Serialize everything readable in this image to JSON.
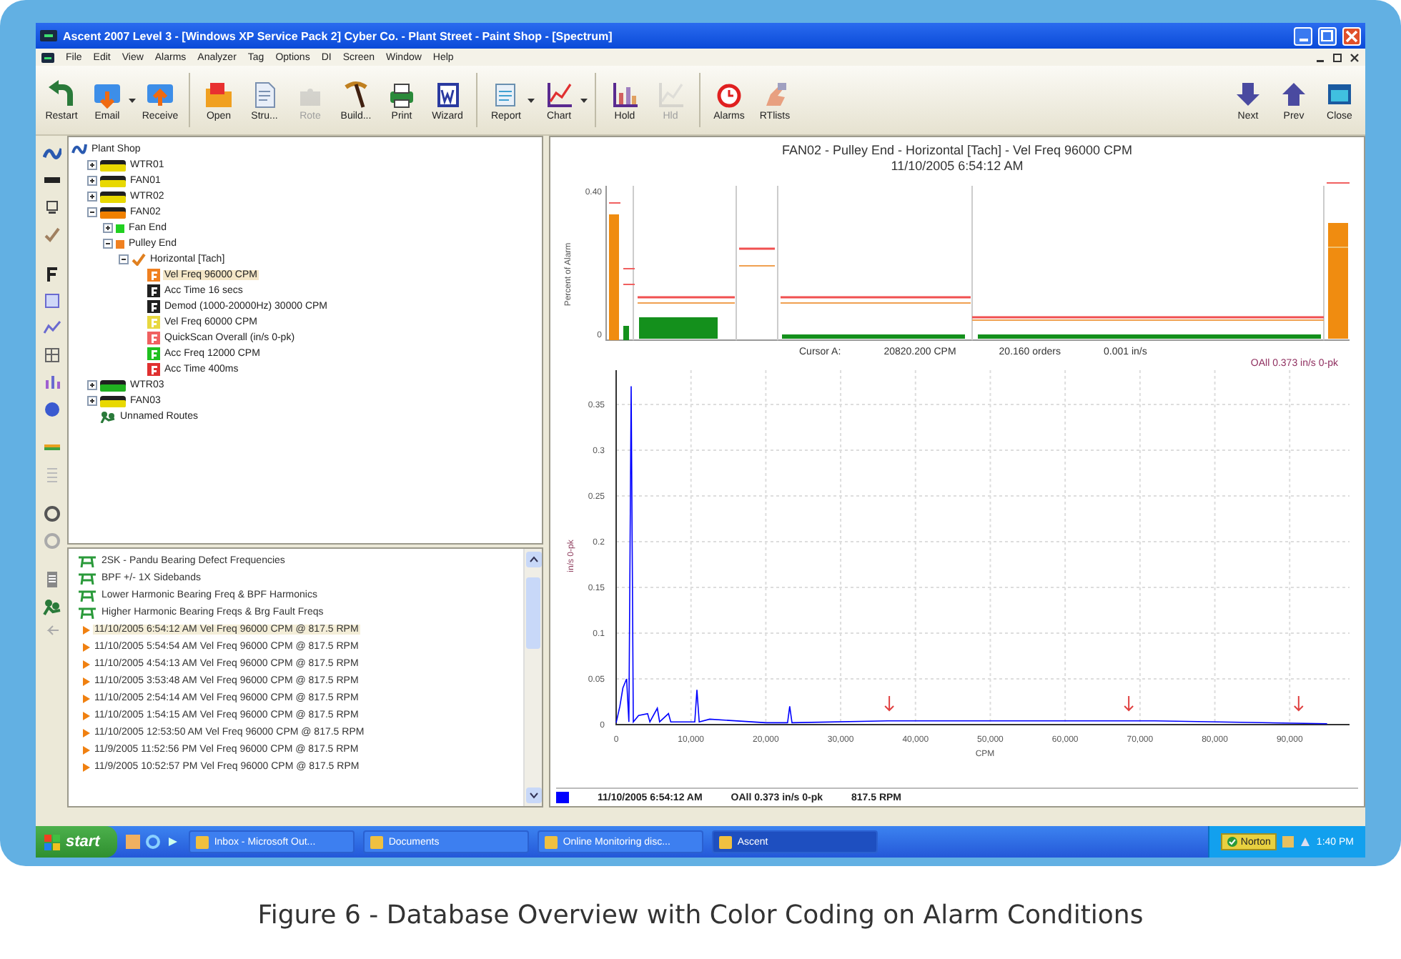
{
  "window": {
    "title": "Ascent 2007 Level 3 - [Windows XP Service Pack 2] Cyber Co. - Plant Street - Paint Shop - [Spectrum]"
  },
  "menu": [
    "File",
    "Edit",
    "View",
    "Alarms",
    "Analyzer",
    "Tag",
    "Options",
    "DI",
    "Screen",
    "Window",
    "Help"
  ],
  "toolbar": [
    {
      "label": "Restart",
      "disabled": false
    },
    {
      "label": "Email",
      "disabled": false,
      "dropdown": true
    },
    {
      "label": "Receive",
      "disabled": false
    },
    {
      "label": "Open",
      "disabled": false
    },
    {
      "label": "Stru...",
      "disabled": false
    },
    {
      "label": "Rote",
      "disabled": true
    },
    {
      "label": "Build...",
      "disabled": false
    },
    {
      "label": "Print",
      "disabled": false
    },
    {
      "label": "Wizard",
      "disabled": false
    },
    {
      "label": "Report",
      "disabled": false,
      "dropdown": true
    },
    {
      "label": "Chart",
      "disabled": false,
      "dropdown": true
    },
    {
      "label": "Hold",
      "disabled": false
    },
    {
      "label": "Hld",
      "disabled": true
    },
    {
      "label": "Alarms",
      "disabled": false
    },
    {
      "label": "RTlists",
      "disabled": false
    },
    {
      "label": "Next",
      "disabled": false
    },
    {
      "label": "Prev",
      "disabled": false
    },
    {
      "label": "Close",
      "disabled": false
    }
  ],
  "tree": [
    {
      "label": "Plant Shop",
      "kind": "plant",
      "selected": false,
      "children": [
        {
          "label": "WTR01",
          "kind": "machine",
          "color": "#e8d800",
          "expanded": false,
          "selected": false
        },
        {
          "label": "FAN01",
          "kind": "machine",
          "color": "#e8d800",
          "expanded": false,
          "selected": false
        },
        {
          "label": "WTR02",
          "kind": "machine",
          "color": "#e8d800",
          "expanded": false,
          "selected": false
        },
        {
          "label": "FAN02",
          "kind": "machine",
          "color": "#f08000",
          "expanded": true,
          "selected": false,
          "children": [
            {
              "label": "Fan End",
              "kind": "point",
              "color": "#20d020",
              "expanded": false,
              "selected": false
            },
            {
              "label": "Pulley End",
              "kind": "point",
              "color": "#f08020",
              "expanded": true,
              "selected": false,
              "children": [
                {
                  "label": "Horizontal [Tach]",
                  "kind": "tag",
                  "expanded": true,
                  "selected": false,
                  "children": [
                    {
                      "label": "Vel Freq 96000 CPM",
                      "kind": "measurement",
                      "color": "#f08020",
                      "selected": true
                    },
                    {
                      "label": "Acc Time 16 secs",
                      "kind": "measurement",
                      "color": "#202020",
                      "selected": false
                    },
                    {
                      "label": "Demod (1000-20000Hz) 30000 CPM",
                      "kind": "measurement",
                      "color": "#202020",
                      "selected": false
                    },
                    {
                      "label": "Vel Freq 60000 CPM",
                      "kind": "measurement",
                      "color": "#e8d840",
                      "selected": false
                    },
                    {
                      "label": "QuickScan Overall (in/s 0-pk)",
                      "kind": "measurement",
                      "color": "#f06060",
                      "selected": false
                    },
                    {
                      "label": "Acc Freq 12000 CPM",
                      "kind": "measurement",
                      "color": "#20c020",
                      "selected": false
                    },
                    {
                      "label": "Acc Time 400ms",
                      "kind": "measurement",
                      "color": "#e03030",
                      "selected": false
                    }
                  ]
                }
              ]
            }
          ]
        },
        {
          "label": "WTR03",
          "kind": "machine",
          "color": "#20b020",
          "expanded": false,
          "selected": false
        },
        {
          "label": "FAN03",
          "kind": "machine",
          "color": "#e8d800",
          "expanded": false,
          "selected": false
        },
        {
          "label": "Unnamed Routes",
          "kind": "route",
          "selected": false
        }
      ]
    }
  ],
  "readings": [
    {
      "kind": "set",
      "label": "2SK - Pandu Bearing Defect Frequencies",
      "selected": false
    },
    {
      "kind": "set",
      "label": "BPF +/- 1X Sidebands",
      "selected": false
    },
    {
      "kind": "set",
      "label": "Lower Harmonic Bearing Freq & BPF Harmonics",
      "selected": false
    },
    {
      "kind": "set",
      "label": "Higher Harmonic Bearing Freqs & Brg Fault Freqs",
      "selected": false
    },
    {
      "kind": "reading",
      "label": "11/10/2005 6:54:12 AM Vel Freq 96000 CPM @ 817.5 RPM",
      "selected": true
    },
    {
      "kind": "reading",
      "label": "11/10/2005 5:54:54 AM Vel Freq 96000 CPM @ 817.5 RPM",
      "selected": false
    },
    {
      "kind": "reading",
      "label": "11/10/2005 4:54:13 AM Vel Freq 96000 CPM @ 817.5 RPM",
      "selected": false
    },
    {
      "kind": "reading",
      "label": "11/10/2005 3:53:48 AM Vel Freq 96000 CPM @ 817.5 RPM",
      "selected": false
    },
    {
      "kind": "reading",
      "label": "11/10/2005 2:54:14 AM Vel Freq 96000 CPM @ 817.5 RPM",
      "selected": false
    },
    {
      "kind": "reading",
      "label": "11/10/2005 1:54:15 AM Vel Freq 96000 CPM @ 817.5 RPM",
      "selected": false
    },
    {
      "kind": "reading",
      "label": "11/10/2005 12:53:50 AM Vel Freq 96000 CPM @ 817.5 RPM",
      "selected": false
    },
    {
      "kind": "reading",
      "label": "11/9/2005 11:52:56 PM Vel Freq 96000 CPM @ 817.5 RPM",
      "selected": false
    },
    {
      "kind": "reading",
      "label": "11/9/2005 10:52:57 PM Vel Freq 96000 CPM @ 817.5 RPM",
      "selected": false
    }
  ],
  "chart": {
    "title": "FAN02 - Pulley End - Horizontal [Tach] - Vel Freq 96000 CPM",
    "subtitle": "11/10/2005 6:54:12 AM",
    "alarm_panel": {
      "ylabel": "Percent of Alarm",
      "yticks": [
        "0.40",
        "0"
      ]
    },
    "cursor": {
      "label": "Cursor A:",
      "frequency": "20820.200 CPM",
      "orders": "20.160 orders",
      "amplitude": "0.001 in/s",
      "overall": "OAll 0.373 in/s 0-pk"
    },
    "chart_data": {
      "type": "line",
      "xlabel": "CPM",
      "ylabel": "in/s 0-pk",
      "x": [
        0,
        500,
        900,
        1400,
        1700,
        2000,
        2300,
        3000,
        4200,
        4500,
        5500,
        5800,
        7000,
        7300,
        10500,
        10800,
        11100,
        12500,
        20000,
        22900,
        23200,
        23500,
        36300,
        50500,
        72000,
        95000
      ],
      "series": [
        {
          "name": "11/10/2005 6:54:12 AM",
          "color": "#0000ff",
          "values": [
            0.002,
            0.02,
            0.04,
            0.05,
            0.003,
            0.37,
            0.003,
            0.01,
            0.012,
            0.003,
            0.018,
            0.003,
            0.012,
            0.003,
            0.003,
            0.038,
            0.003,
            0.006,
            0.002,
            0.002,
            0.02,
            0.002,
            0.004,
            0.004,
            0.004,
            0.001
          ]
        }
      ],
      "xlim": [
        0,
        98000
      ],
      "ylim": [
        0,
        0.3875
      ],
      "grid": true,
      "yticks": [
        0,
        0.05,
        0.1,
        0.15,
        0.2,
        0.25,
        0.3,
        0.35
      ],
      "xticks": [
        0,
        {
          "value": 10000,
          "label": "10,000"
        },
        {
          "value": 20000,
          "label": "20,000"
        },
        {
          "value": 30000,
          "label": "30,000"
        },
        {
          "value": 40000,
          "label": "40,000"
        },
        {
          "value": 50000,
          "label": "50,000"
        },
        {
          "value": 60000,
          "label": "60,000"
        },
        {
          "value": 70000,
          "label": "70,000"
        },
        {
          "value": 80000,
          "label": "80,000"
        },
        {
          "value": 90000,
          "label": "90,000"
        }
      ]
    },
    "legend": {
      "overall": "OAll 0.373 in/s 0-pk",
      "speed": "817.5 RPM"
    }
  },
  "taskbar": {
    "start": "start",
    "tasks": [
      {
        "label": "Inbox - Microsoft Out...",
        "selected": false
      },
      {
        "label": "Documents",
        "selected": false
      },
      {
        "label": "Online Monitoring disc...",
        "selected": false
      },
      {
        "label": "Ascent",
        "selected": true
      }
    ],
    "tray_app": "Norton",
    "clock": "1:40 PM"
  },
  "caption": "Figure 6 - Database Overview with Color Coding on Alarm Conditions"
}
